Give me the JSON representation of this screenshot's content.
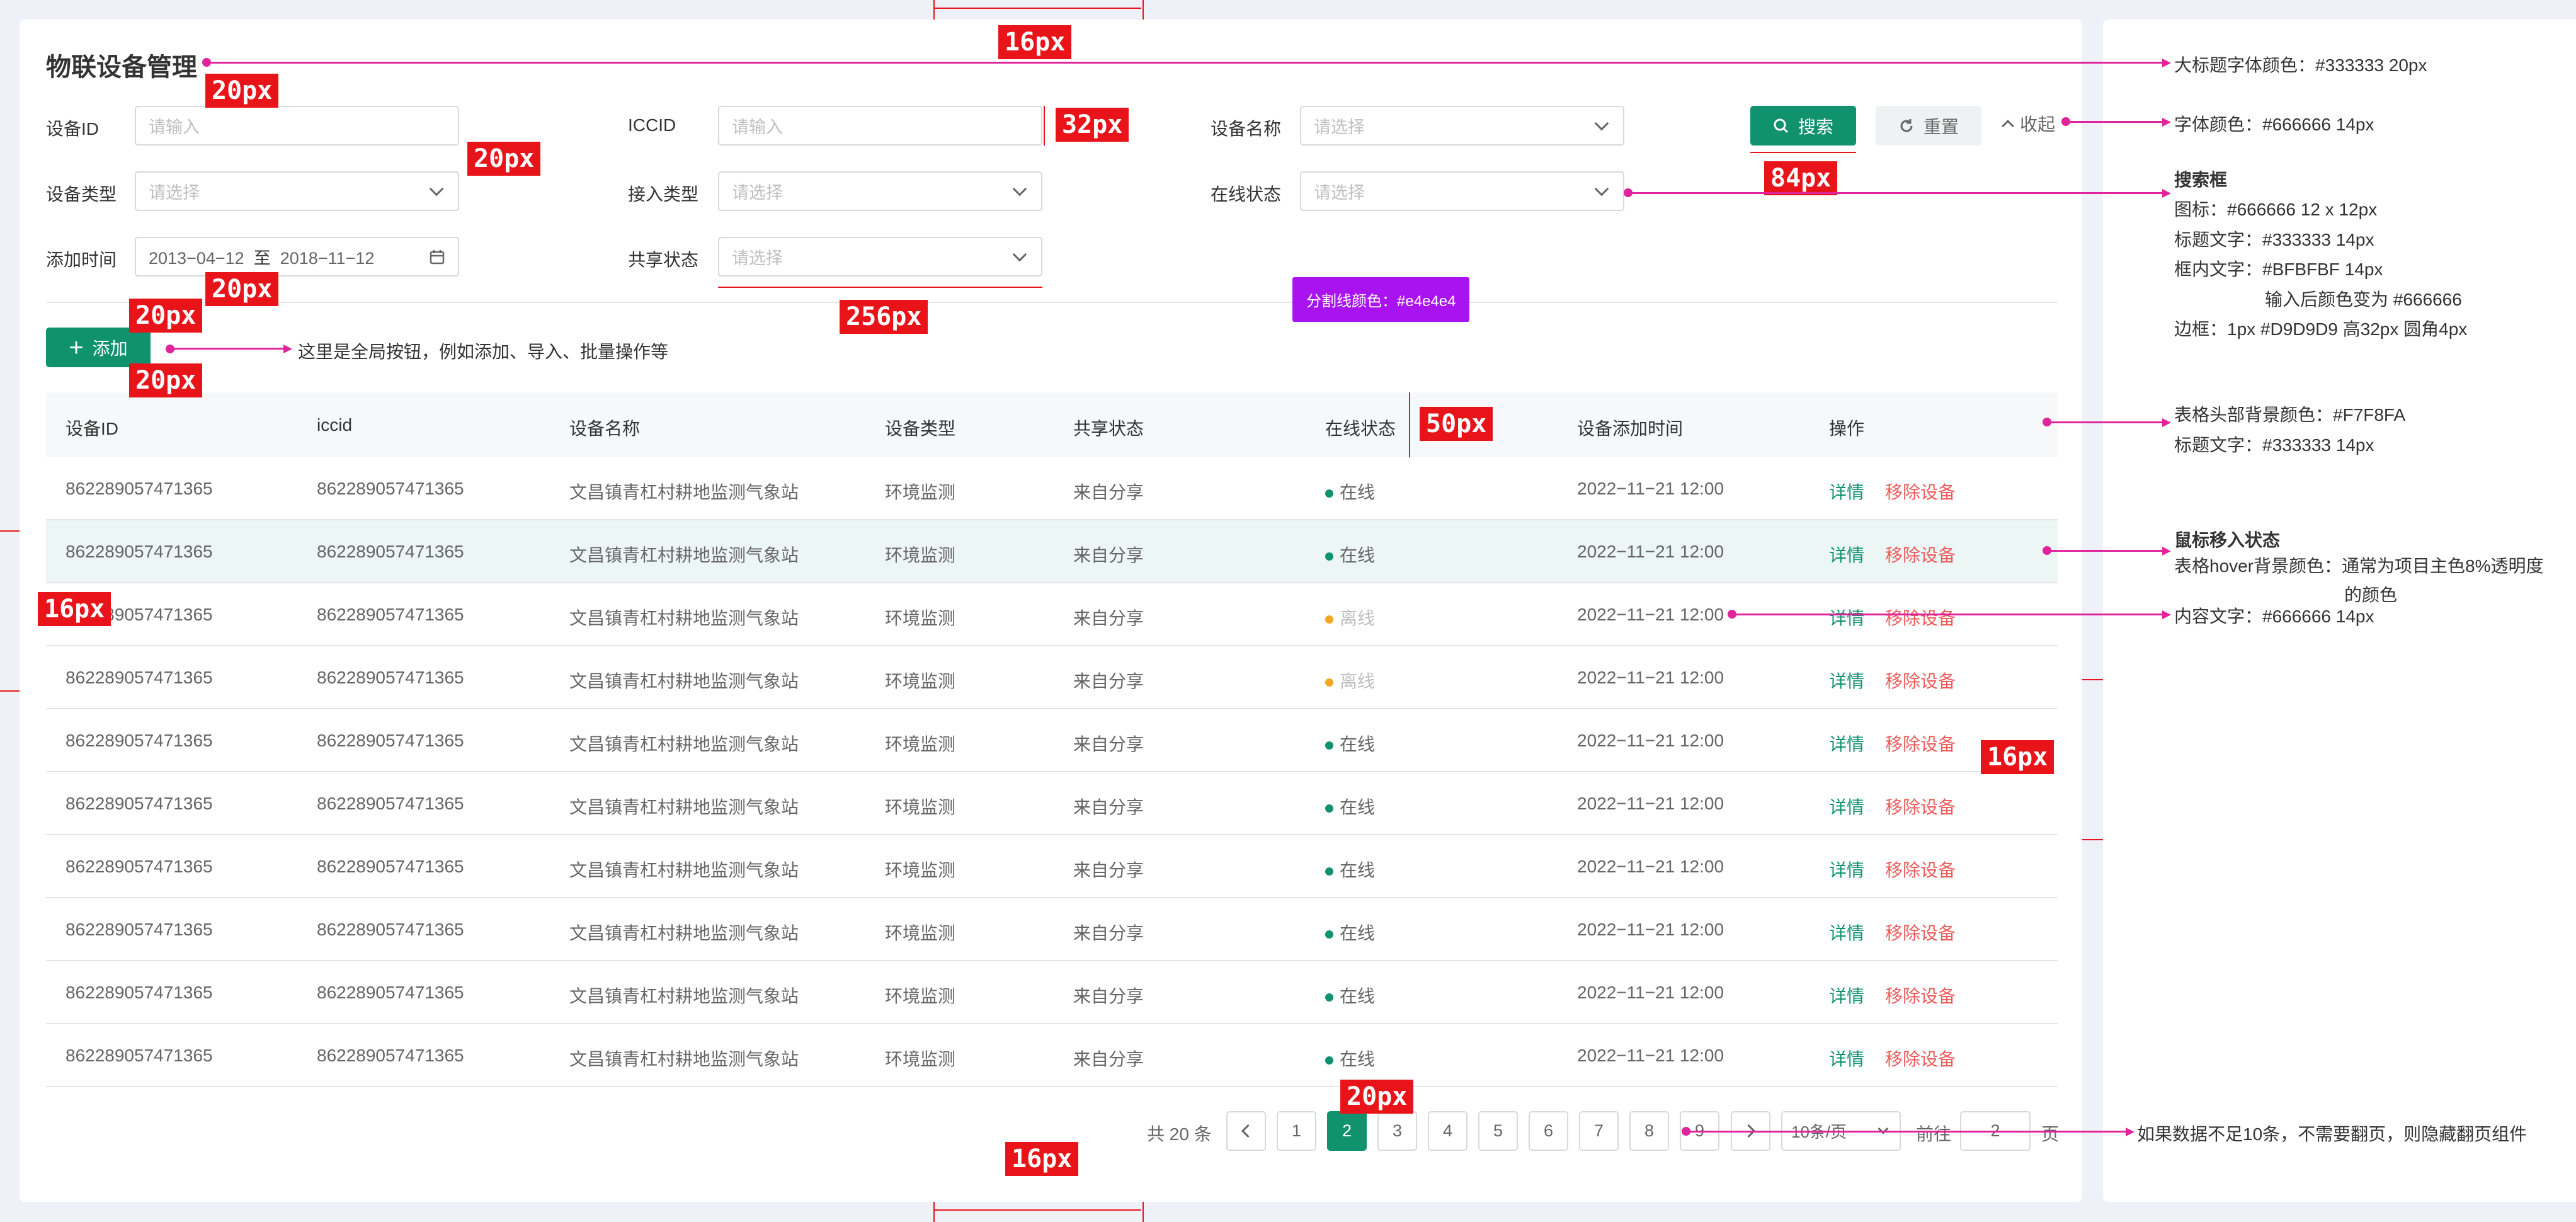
{
  "page": {
    "title": "物联设备管理"
  },
  "search": {
    "fields": [
      {
        "label": "设备ID",
        "placeholder": "请输入",
        "type": "input"
      },
      {
        "label": "ICCID",
        "placeholder": "请输入",
        "type": "input"
      },
      {
        "label": "设备名称",
        "placeholder": "请选择",
        "type": "select"
      },
      {
        "label": "设备类型",
        "placeholder": "请选择",
        "type": "select"
      },
      {
        "label": "接入类型",
        "placeholder": "请选择",
        "type": "select"
      },
      {
        "label": "在线状态",
        "placeholder": "请选择",
        "type": "select"
      },
      {
        "label": "添加时间",
        "type": "daterange",
        "start": "2013−04−12",
        "sep": "至",
        "end": "2018−11−12"
      },
      {
        "label": "共享状态",
        "placeholder": "请选择",
        "type": "select"
      }
    ],
    "search_label": "搜索",
    "reset_label": "重置",
    "collapse_label": "收起"
  },
  "toolbar": {
    "add_label": "添加"
  },
  "table": {
    "columns": [
      "设备ID",
      "iccid",
      "设备名称",
      "设备类型",
      "共享状态",
      "在线状态",
      "设备添加时间",
      "操作"
    ],
    "rows": [
      {
        "id": "862289057471365",
        "iccid": "862289057471365",
        "name": "文昌镇青杠村耕地监测气象站",
        "type": "环境监测",
        "share": "来自分享",
        "status": "在线",
        "online": true,
        "time": "2022−11−21 12:00"
      },
      {
        "id": "862289057471365",
        "iccid": "862289057471365",
        "name": "文昌镇青杠村耕地监测气象站",
        "type": "环境监测",
        "share": "来自分享",
        "status": "在线",
        "online": true,
        "time": "2022−11−21 12:00"
      },
      {
        "id": "862289057471365",
        "iccid": "862289057471365",
        "name": "文昌镇青杠村耕地监测气象站",
        "type": "环境监测",
        "share": "来自分享",
        "status": "离线",
        "online": false,
        "time": "2022−11−21 12:00"
      },
      {
        "id": "862289057471365",
        "iccid": "862289057471365",
        "name": "文昌镇青杠村耕地监测气象站",
        "type": "环境监测",
        "share": "来自分享",
        "status": "离线",
        "online": false,
        "time": "2022−11−21 12:00"
      },
      {
        "id": "862289057471365",
        "iccid": "862289057471365",
        "name": "文昌镇青杠村耕地监测气象站",
        "type": "环境监测",
        "share": "来自分享",
        "status": "在线",
        "online": true,
        "time": "2022−11−21 12:00"
      },
      {
        "id": "862289057471365",
        "iccid": "862289057471365",
        "name": "文昌镇青杠村耕地监测气象站",
        "type": "环境监测",
        "share": "来自分享",
        "status": "在线",
        "online": true,
        "time": "2022−11−21 12:00"
      },
      {
        "id": "862289057471365",
        "iccid": "862289057471365",
        "name": "文昌镇青杠村耕地监测气象站",
        "type": "环境监测",
        "share": "来自分享",
        "status": "在线",
        "online": true,
        "time": "2022−11−21 12:00"
      },
      {
        "id": "862289057471365",
        "iccid": "862289057471365",
        "name": "文昌镇青杠村耕地监测气象站",
        "type": "环境监测",
        "share": "来自分享",
        "status": "在线",
        "online": true,
        "time": "2022−11−21 12:00"
      },
      {
        "id": "862289057471365",
        "iccid": "862289057471365",
        "name": "文昌镇青杠村耕地监测气象站",
        "type": "环境监测",
        "share": "来自分享",
        "status": "在线",
        "online": true,
        "time": "2022−11−21 12:00"
      },
      {
        "id": "862289057471365",
        "iccid": "862289057471365",
        "name": "文昌镇青杠村耕地监测气象站",
        "type": "环境监测",
        "share": "来自分享",
        "status": "在线",
        "online": true,
        "time": "2022−11−21 12:00"
      }
    ],
    "action_detail": "详情",
    "action_remove": "移除设备",
    "hover_row_index": 1
  },
  "pagination": {
    "total_label": "共 20 条",
    "pages": [
      "1",
      "2",
      "3",
      "4",
      "5",
      "6",
      "7",
      "8",
      "9"
    ],
    "current_page": 2,
    "prev_icon": "chevron-left-icon",
    "next_icon": "chevron-right-icon",
    "page_size": "10条/页",
    "goto_label": "前往",
    "goto_value": "2",
    "page_unit": "页"
  },
  "annotations": {
    "spacing_tags": [
      "16px",
      "20px",
      "20px",
      "32px",
      "84px",
      "20px",
      "20px",
      "20px",
      "20px",
      "256px",
      "50px",
      "16px",
      "16px",
      "20px",
      "16px"
    ],
    "divider_color_note": "分割线颜色：#e4e4e4",
    "global_button_note": "这里是全局按钮，例如添加、导入、批量操作等",
    "notes": {
      "title_color": "大标题字体颜色：#333333  20px",
      "font_color": "字体颜色：#666666  14px",
      "search_box_title": "搜索框",
      "search_box_icon": "图标：#666666  12 x 12px",
      "search_box_label": "标题文字：#333333  14px",
      "search_box_text": "框内文字：#BFBFBF    14px",
      "search_box_text2": "输入后颜色变为 #666666",
      "search_box_border": "边框：1px #D9D9D9  高32px  圆角4px",
      "table_head_bg": "表格头部背景颜色：#F7F8FA",
      "table_head_text": "标题文字：#333333    14px",
      "hover_title": "鼠标移入状态",
      "hover_desc": "表格hover背景颜色：通常为项目主色8%透明度",
      "hover_desc2": "的颜色",
      "content_text": "内容文字：#666666    14px",
      "pagination_note": "如果数据不足10条，不需要翻页，则隐藏翻页组件"
    }
  },
  "colors": {
    "primary": "#10926F",
    "danger": "#F05A5A",
    "warning": "#F5A623",
    "annotation": "#E0259C",
    "tag": "#E8141A",
    "purple": "#A813F0"
  }
}
